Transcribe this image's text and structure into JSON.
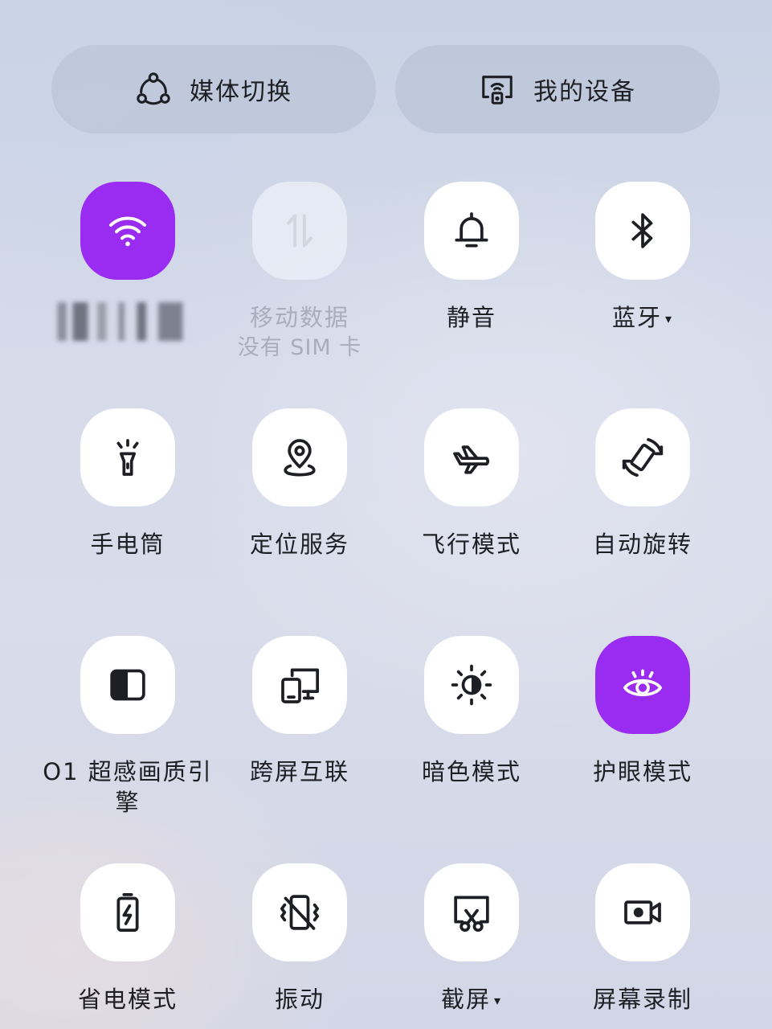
{
  "top_buttons": {
    "media": {
      "label": "媒体切换",
      "icon": "media-switch-icon"
    },
    "devices": {
      "label": "我的设备",
      "icon": "my-devices-icon"
    }
  },
  "tiles": {
    "wifi": {
      "label": "",
      "icon": "wifi-icon",
      "state": "on"
    },
    "mobile_data": {
      "label": "移动数据",
      "sub": "没有 SIM 卡",
      "icon": "mobile-data-icon",
      "state": "disabled"
    },
    "silent": {
      "label": "静音",
      "icon": "bell-icon",
      "state": "off"
    },
    "bluetooth": {
      "label": "蓝牙",
      "caret": "▾",
      "icon": "bluetooth-icon",
      "state": "off"
    },
    "flashlight": {
      "label": "手电筒",
      "icon": "flashlight-icon",
      "state": "off"
    },
    "location": {
      "label": "定位服务",
      "icon": "location-icon",
      "state": "off"
    },
    "airplane": {
      "label": "飞行模式",
      "icon": "airplane-icon",
      "state": "off"
    },
    "auto_rotate": {
      "label": "自动旋转",
      "icon": "rotate-icon",
      "state": "off"
    },
    "display_engine": {
      "label": "O1 超感画质引擎",
      "icon": "display-engine-icon",
      "state": "off"
    },
    "screen_cast": {
      "label": "跨屏互联",
      "icon": "screen-cast-icon",
      "state": "off"
    },
    "dark_mode": {
      "label": "暗色模式",
      "icon": "dark-mode-icon",
      "state": "off"
    },
    "eye_comfort": {
      "label": "护眼模式",
      "icon": "eye-icon",
      "state": "on"
    },
    "battery_saver": {
      "label": "省电模式",
      "icon": "battery-icon",
      "state": "off"
    },
    "vibrate": {
      "label": "振动",
      "icon": "vibrate-icon",
      "state": "off"
    },
    "screenshot": {
      "label": "截屏",
      "caret": "▾",
      "icon": "screenshot-icon",
      "state": "off"
    },
    "screen_record": {
      "label": "屏幕录制",
      "icon": "screen-record-icon",
      "state": "off"
    }
  },
  "colors": {
    "accent": "#9a2cf2",
    "tile_bg": "#ffffff",
    "label": "#1e1f24",
    "disabled_text": "#a9aebb"
  }
}
